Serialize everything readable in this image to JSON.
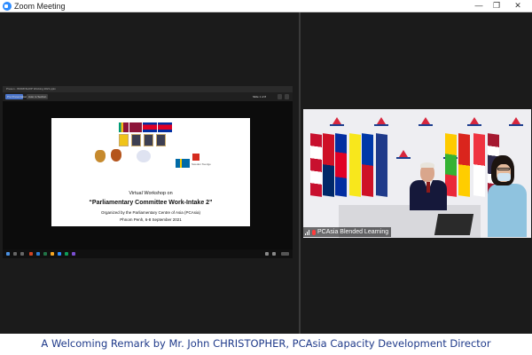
{
  "window": {
    "title": "Zoom Meeting",
    "controls": {
      "minimize": "—",
      "maximize": "❐",
      "close": "✕"
    },
    "icon": "zoom-camera-icon"
  },
  "shared_screen": {
    "app_title": "Presen - WORKSHOP Working 2021.pptx",
    "toolbar": {
      "present_label": "Pre Presentation",
      "notes_label": "Auto to Section",
      "more_label": "Slide 1 of 8"
    },
    "slide": {
      "heading": "Virtual Workshop on",
      "title": "“Parliamentary Committee Work-Intake 2”",
      "organized_by": "Organized by the Parliamentary Centre of Asia (PCAsia)",
      "location_date": "Phnom Penh, 6-8 September 2021",
      "sweden_label": "Sweden\nSverige",
      "colors": {
        "flag_sri_lanka": "#8d153a",
        "flag_cambodia_blue": "#032ea1",
        "flag_cambodia_red": "#e00025",
        "flag_sweden": "#006aa7",
        "flag_sweden_cross": "#fecc00",
        "flag_swiss": "#d52b1e"
      }
    }
  },
  "participant": {
    "name": "PCAsia Blended Learning",
    "mic_status": "muted"
  },
  "caption": "A Welcoming Remark by Mr. John CHRISTOPHER, PCAsia Capacity Development Director",
  "colors": {
    "caption_text": "#1f3a8a",
    "zoom_blue": "#2d8cff",
    "stage_bg": "#1b1b1b"
  }
}
